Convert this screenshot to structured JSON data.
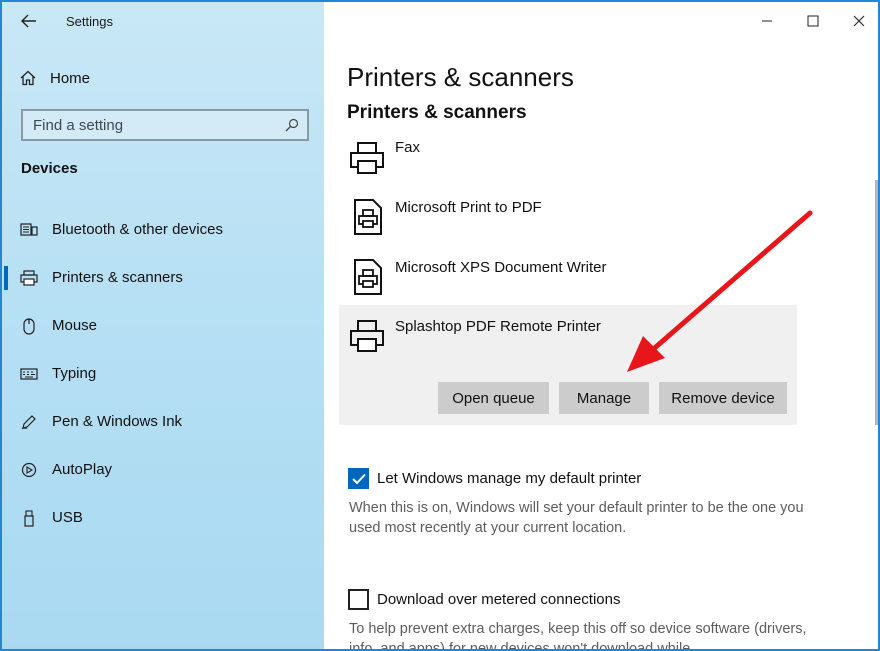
{
  "window": {
    "title": "Settings"
  },
  "sidebar": {
    "home_label": "Home",
    "search_placeholder": "Find a setting",
    "section_title": "Devices",
    "items": [
      {
        "label": "Bluetooth & other devices",
        "icon": "bluetooth-devices-icon"
      },
      {
        "label": "Printers & scanners",
        "icon": "printer-icon",
        "active": true
      },
      {
        "label": "Mouse",
        "icon": "mouse-icon"
      },
      {
        "label": "Typing",
        "icon": "keyboard-icon"
      },
      {
        "label": "Pen & Windows Ink",
        "icon": "pen-icon"
      },
      {
        "label": "AutoPlay",
        "icon": "autoplay-icon"
      },
      {
        "label": "USB",
        "icon": "usb-icon"
      }
    ]
  },
  "main": {
    "page_title": "Printers & scanners",
    "section_title": "Printers & scanners",
    "printers": [
      {
        "name": "Fax",
        "icon": "printer-icon"
      },
      {
        "name": "Microsoft Print to PDF",
        "icon": "document-printer-icon"
      },
      {
        "name": "Microsoft XPS Document Writer",
        "icon": "document-printer-icon"
      },
      {
        "name": "Splashtop PDF Remote Printer",
        "icon": "printer-icon",
        "selected": true
      }
    ],
    "buttons": {
      "open_queue": "Open queue",
      "manage": "Manage",
      "remove_device": "Remove device"
    },
    "default_printer": {
      "label": "Let Windows manage my default printer",
      "checked": true,
      "description": "When this is on, Windows will set your default printer to be the one you used most recently at your current location."
    },
    "metered": {
      "label": "Download over metered connections",
      "checked": false,
      "description": "To help prevent extra charges, keep this off so device software (drivers, info, and apps) for new devices won't download while"
    }
  },
  "colors": {
    "accent": "#0067c0",
    "annotation_arrow": "#e8161b",
    "frame_border": "#1f86d8"
  }
}
